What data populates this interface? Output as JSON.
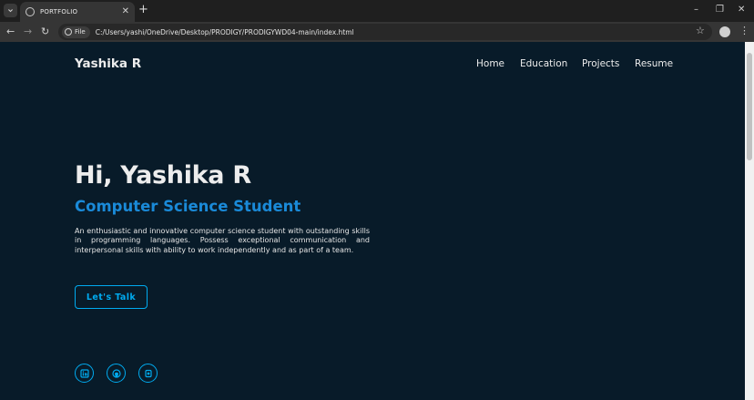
{
  "browser": {
    "tab_title": "PORTFOLIO",
    "close_glyph": "✕",
    "new_tab_glyph": "+",
    "window_controls": {
      "minimize": "–",
      "restore": "❐",
      "close": "✕"
    },
    "nav_glyphs": {
      "back": "←",
      "forward": "→",
      "reload": "↻"
    },
    "chip_label": "File",
    "url": "C:/Users/yashi/OneDrive/Desktop/PRODIGY/PRODIGYWD04-main/index.html",
    "bookmark_glyph": "☆",
    "menu_glyph": "⋮"
  },
  "site": {
    "logo": "Yashika R",
    "nav": [
      "Home",
      "Education",
      "Projects",
      "Resume"
    ],
    "hero": {
      "title": "Hi, Yashika R",
      "subtitle": "Computer Science Student",
      "description": "An enthusiastic and innovative computer science student with outstanding skills in programming languages. Possess exceptional communication and interpersonal skills with ability to work independently and as part of a team.",
      "cta_label": "Let's Talk"
    },
    "social_icons": [
      "linkedin-icon",
      "github-icon",
      "portfolio-icon"
    ]
  },
  "colors": {
    "page_bg": "#081b29",
    "accent": "#00abf0",
    "subtitle": "#1a8ad8",
    "text": "#ededed"
  }
}
